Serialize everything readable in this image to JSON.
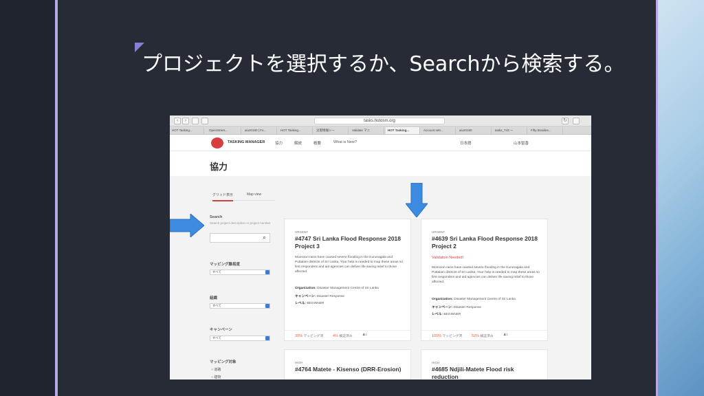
{
  "slide": {
    "title": "プロジェクトを選択するか、Searchから検索する。"
  },
  "browser": {
    "url": "tasks.hotosm.org",
    "tabs": [
      "HOT Tasking...",
      "OpenStreet...",
      "aiu20180 | Fo...",
      "HOT Tasking...",
      "災害情報シー",
      "Validate マニ",
      "HOT Tasking...",
      "Account sett...",
      "aiu20180",
      "tasks_T43 ー",
      "Fifty Brasiles..."
    ]
  },
  "tm": {
    "logo_text": "TASKING MANAGER",
    "nav": [
      "協力",
      "解説",
      "概要",
      "What is New?"
    ],
    "language": "日本語",
    "user": "山本智香",
    "page_title": "協力",
    "view_tabs": [
      "グリッド表示",
      "Map view"
    ],
    "search_label": "Search",
    "search_hint": "Search project description or project number",
    "filters": [
      {
        "label": "マッピング難易度",
        "value": "すべて"
      },
      {
        "label": "組織",
        "value": "すべて"
      },
      {
        "label": "キャンペーン",
        "value": "すべて"
      }
    ],
    "mapping_types_label": "マッピング対象",
    "mapping_types": [
      "道路",
      "建物"
    ]
  },
  "cards": [
    {
      "tag": "URGENT",
      "title": "#4747 Sri Lanka Flood Response 2018 Project 3",
      "warning": "",
      "desc": "Monsoon rains have caused severe flooding in the Kurunagala and Puttalam districts of Sri Lanka. Your help is needed to map these areas so first responders and aid agencies can deliver life saving relief to those affected.",
      "org_label": "Organization:",
      "org": "Disaster Management Centre of Sri Lanka",
      "campaign_label": "キャンペーン:",
      "campaign": "Disaster Response",
      "level_label": "レベル:",
      "level": "BEGINNER",
      "mapped": "30%",
      "mapped_label": "マッピング済",
      "validated": "4%",
      "validated_label": "検証済み",
      "contributors": "1"
    },
    {
      "tag": "URGENT",
      "title": "#4639 Sri Lanka Flood Response 2018 Project 2",
      "warning": "Validation Needed!",
      "desc": "Monsoon rains have caused severe flooding in the Kurunagala and Puttalam districts of Sri Lanka. Your help is needed to map these areas so first responders and aid agencies can deliver life saving relief to those affected.",
      "org_label": "Organization:",
      "org": "Disaster Management Centre of Sri Lanka",
      "campaign_label": "キャンペーン:",
      "campaign": "Disaster Response",
      "level_label": "レベル:",
      "level": "BEGINNER",
      "mapped": "100%",
      "mapped_label": "マッピング済",
      "validated": "52%",
      "validated_label": "検証済み",
      "contributors": "1"
    },
    {
      "tag": "HIGH",
      "title": "#4764 Matete - Kisenso (DRR-Erosion)"
    },
    {
      "tag": "HIGH",
      "title": "#4685 Ndjili-Matete Flood risk reduction"
    }
  ],
  "colors": {
    "slide_bg": "#262b36",
    "accent_purple": "#b7a8e8",
    "arrow_blue": "#3d8be0",
    "brand_red": "#d73f3f"
  }
}
